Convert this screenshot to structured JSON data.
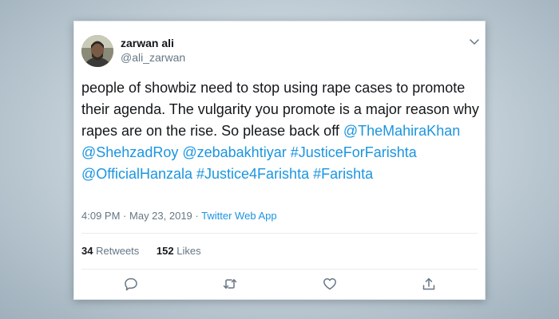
{
  "user": {
    "display_name": "zarwan ali",
    "handle": "@ali_zarwan"
  },
  "tweet": {
    "text_plain_1": "people of showbiz need to stop using rape cases to promote their agenda. The vulgarity you promote is a major reason why rapes are on the rise. So please back off ",
    "mentions": [
      "@TheMahiraKhan",
      "@ShehzadRoy",
      "@zebabakhtiyar"
    ],
    "hashtags": [
      "#JusticeForFarishta",
      "#Justice4Farishta",
      "#Farishta"
    ],
    "mention_4": "@OfficialHanzala",
    "time": "4:09 PM",
    "separator": "·",
    "date": "May 23, 2019",
    "source": "Twitter Web App"
  },
  "stats": {
    "retweets_count": "34",
    "retweets_label": "Retweets",
    "likes_count": "152",
    "likes_label": "Likes"
  },
  "icons": {
    "menu": "chevron-down-icon",
    "reply": "reply-icon",
    "retweet": "retweet-icon",
    "like": "heart-icon",
    "share": "share-icon"
  },
  "colors": {
    "link": "#1b95e0",
    "text": "#14171a",
    "secondary": "#657786"
  }
}
